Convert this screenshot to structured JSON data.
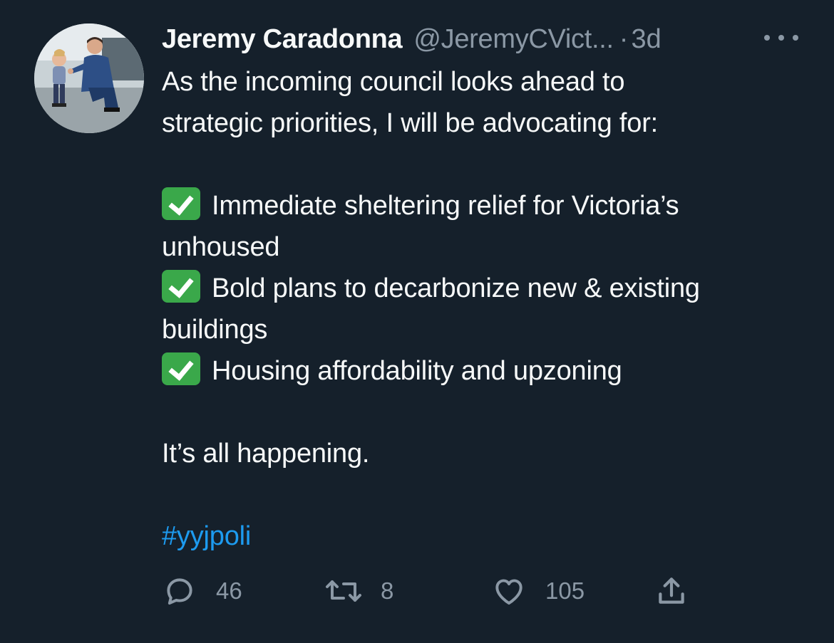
{
  "tweet": {
    "author": {
      "display_name": "Jeremy Caradonna",
      "handle": "@JeremyCVict...",
      "separator": "·",
      "time": "3d"
    },
    "lines": {
      "l1": "As the incoming council looks ahead to",
      "l2": "strategic priorities, I will be advocating for:",
      "l3": "Immediate sheltering relief for Victoria’s",
      "l4": "unhoused",
      "l5": "Bold plans to decarbonize new & existing",
      "l6": "buildings",
      "l7": "Housing affordability and upzoning",
      "l8": "It’s all happening.",
      "hashtag": "#yyjpoli"
    },
    "actions": {
      "replies": "46",
      "retweets": "8",
      "likes": "105"
    },
    "icons": {
      "reply": "reply-icon",
      "retweet": "retweet-icon",
      "like": "heart-icon",
      "share": "share-icon",
      "more": "more-icon",
      "check": "check-mark-button-emoji"
    },
    "colors": {
      "background": "#15202b",
      "text": "#f7f9f9",
      "secondary": "#8b98a5",
      "link": "#1d9bf0",
      "check_green": "#3aa84a"
    }
  }
}
